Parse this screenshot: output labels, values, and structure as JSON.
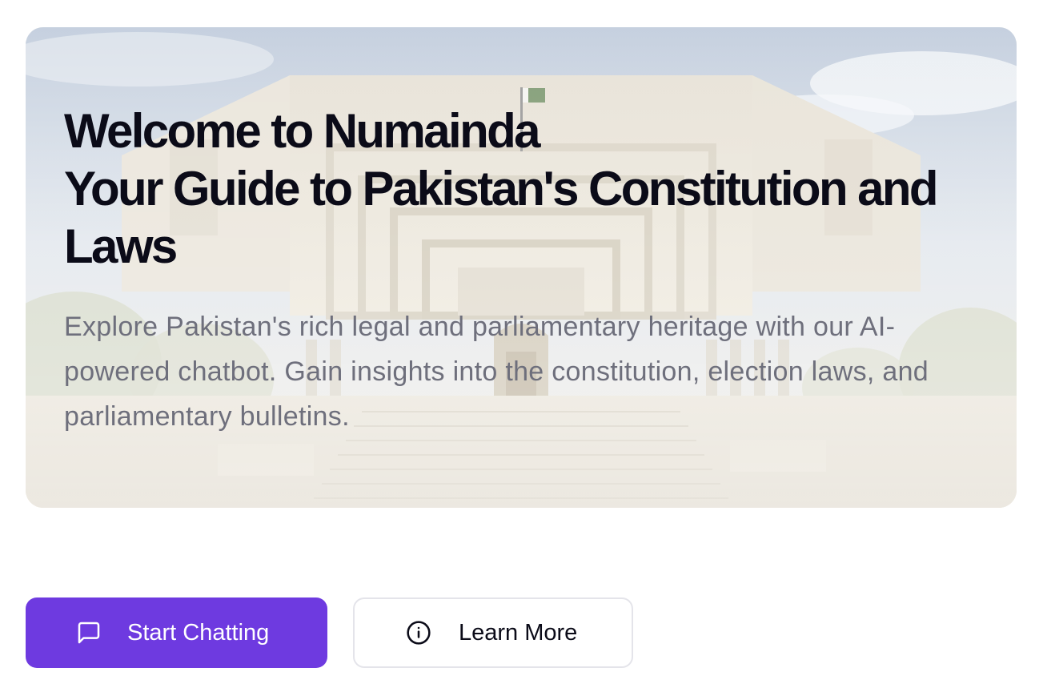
{
  "hero": {
    "title_line1": "Welcome to Numainda",
    "title_line2": "Your Guide to Pakistan's Constitution and",
    "title_line3": "Laws",
    "description": "Explore Pakistan's rich legal and parliamentary heritage with our AI-powered chatbot. Gain insights into the constitution, election laws, and parliamentary bulletins.",
    "background": "supreme-court-building-image"
  },
  "actions": {
    "start_chatting": {
      "label": "Start Chatting",
      "icon": "message-square-icon"
    },
    "learn_more": {
      "label": "Learn More",
      "icon": "info-icon"
    }
  },
  "colors": {
    "primary": "#6e3ae0",
    "title": "#0b0b18",
    "description": "#6e6f7c",
    "secondary_border": "#e4e4ea"
  }
}
